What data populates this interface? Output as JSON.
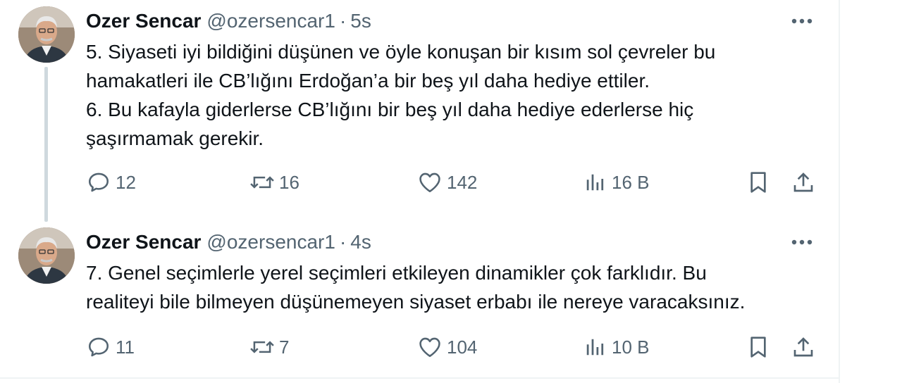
{
  "tweets": [
    {
      "author": "Ozer Sencar",
      "handle": "@ozersencar1",
      "separator": "·",
      "time": "5s",
      "lines": [
        "5. Siyaseti iyi bildiğini düşünen ve öyle konuşan bir kısım sol çevreler bu",
        "hamakatleri ile CB’lığını Erdoğan’a bir beş yıl daha hediye ettiler.",
        "6. Bu kafayla giderlerse CB’lığını bir beş yıl daha hediye ederlerse hiç",
        "şaşırmamak gerekir."
      ],
      "replies": "12",
      "reposts": "16",
      "likes": "142",
      "views": "16 B"
    },
    {
      "author": "Ozer Sencar",
      "handle": "@ozersencar1",
      "separator": "·",
      "time": "4s",
      "lines": [
        "7. Genel seçimlerle yerel seçimleri etkileyen dinamikler çok farklıdır. Bu",
        "realiteyi bile bilmeyen düşünemeyen siyaset erbabı ile nereye varacaksınız."
      ],
      "replies": "11",
      "reposts": "7",
      "likes": "104",
      "views": "10 B"
    }
  ],
  "icons": {
    "more": "more-dots-icon",
    "reply": "reply-bubble-icon",
    "repost": "repost-arrows-icon",
    "like": "heart-icon",
    "views": "views-bars-icon",
    "bookmark": "bookmark-icon",
    "share": "share-upload-icon"
  },
  "colors": {
    "text": "#0f1419",
    "muted": "#536471",
    "thread_line": "#cfd9de"
  }
}
